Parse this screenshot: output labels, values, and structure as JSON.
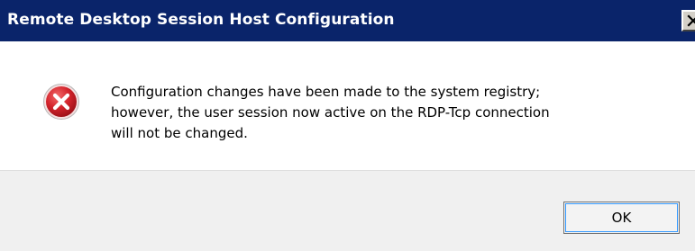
{
  "window": {
    "title": "Remote Desktop Session Host Configuration",
    "close_glyph": "close-icon"
  },
  "message": {
    "icon": "error-icon",
    "line1": "Configuration changes have been made to the system registry;",
    "line2": "however, the user session now active on the RDP-Tcp connection",
    "line3": "will not be changed."
  },
  "buttons": {
    "ok_label": "OK"
  },
  "colors": {
    "titlebar": "#0a246a",
    "error_red": "#c8202a"
  }
}
